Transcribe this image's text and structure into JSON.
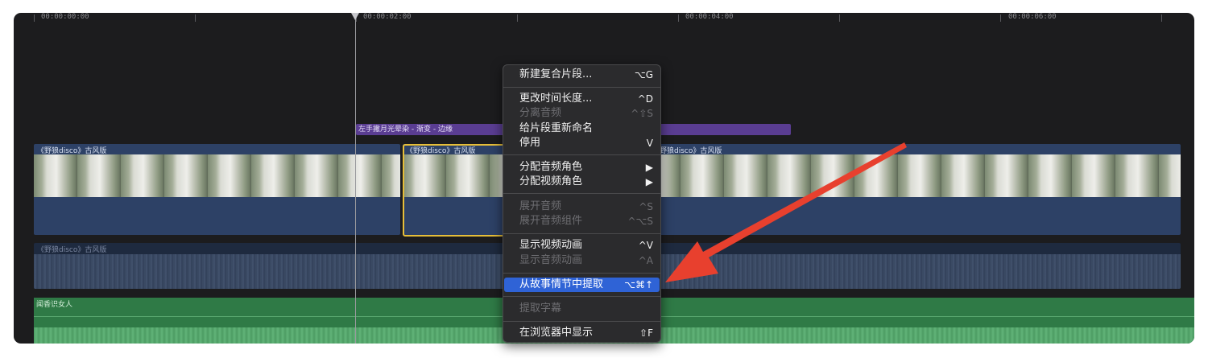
{
  "ruler": {
    "timecodes": [
      "00:00:00:00",
      "00:00:02:00",
      "00:00:04:00",
      "00:00:06:00"
    ]
  },
  "title_clip": {
    "label": "左手撇月光晕染 - 渐变 - 边缘"
  },
  "video_clips": [
    {
      "label": "《野狼disco》古风版"
    },
    {
      "label": "《野狼disco》古风版"
    },
    {
      "label": "野狼disco》古风版"
    }
  ],
  "audio_clip": {
    "label": "《野狼disco》古风版"
  },
  "music_clip": {
    "label": "闻香识女人"
  },
  "context_menu": {
    "items": [
      {
        "label": "新建复合片段...",
        "shortcut": "⌥G",
        "enabled": true
      },
      {
        "label": "更改时间长度...",
        "shortcut": "^D",
        "enabled": true
      },
      {
        "label": "分离音频",
        "shortcut": "^⇧S",
        "enabled": false
      },
      {
        "label": "给片段重新命名",
        "shortcut": "",
        "enabled": true
      },
      {
        "label": "停用",
        "shortcut": "V",
        "enabled": true
      },
      {
        "label": "分配音频角色",
        "shortcut": "▶",
        "enabled": true
      },
      {
        "label": "分配视频角色",
        "shortcut": "▶",
        "enabled": true
      },
      {
        "label": "展开音频",
        "shortcut": "^S",
        "enabled": false
      },
      {
        "label": "展开音频组件",
        "shortcut": "^⌥S",
        "enabled": false
      },
      {
        "label": "显示视频动画",
        "shortcut": "^V",
        "enabled": true
      },
      {
        "label": "显示音频动画",
        "shortcut": "^A",
        "enabled": false
      },
      {
        "label": "从故事情节中提取",
        "shortcut": "⌥⌘↑",
        "enabled": true,
        "highlighted": true
      },
      {
        "label": "提取字幕",
        "shortcut": "",
        "enabled": false
      },
      {
        "label": "在浏览器中显示",
        "shortcut": "⇧F",
        "enabled": true
      }
    ]
  },
  "colors": {
    "background": "#1c1c1e",
    "highlight": "#2f63d6",
    "selection_border": "#e6be39",
    "title_clip": "#5a3d92",
    "video_clip": "#2d4166",
    "music_clip": "#2f7a46",
    "annotation_arrow": "#e8402e"
  }
}
